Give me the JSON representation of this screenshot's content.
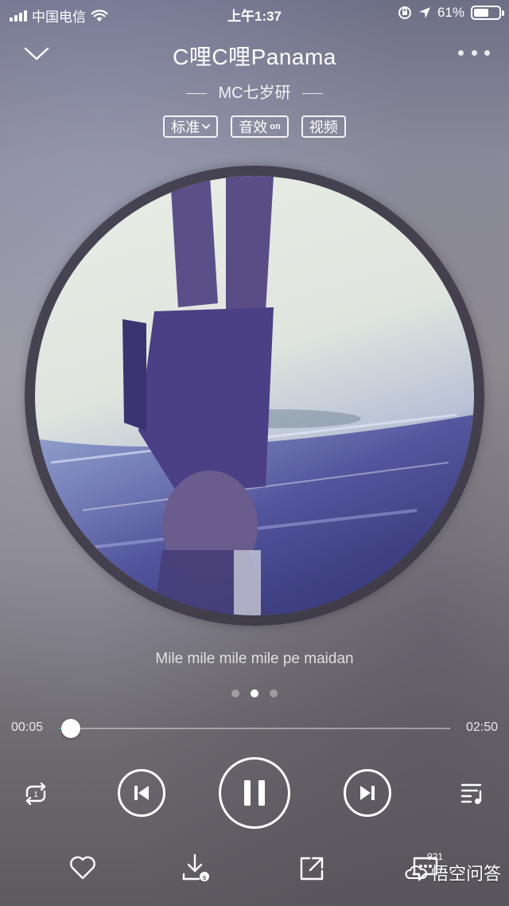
{
  "status_bar": {
    "carrier": "中国电信",
    "time": "上午1:37",
    "battery_text": "61%",
    "battery_level": 0.61
  },
  "header": {
    "title": "C哩C哩Panama",
    "artist": "MC七岁研",
    "chips": {
      "quality": "标准",
      "effects": "音效",
      "effects_state": "on",
      "video": "视频"
    }
  },
  "player": {
    "lyric": "Mile mile mile mile pe maidan",
    "pager_active": 1,
    "current_time": "00:05",
    "total_time": "02:50",
    "progress": 0.03,
    "state": "playing"
  },
  "bottom": {
    "comment_count": "921",
    "watermark": "悟空问答"
  },
  "colors": {
    "accent": "#31c27c"
  },
  "icons": [
    "collapse-chevron-icon",
    "more-icon",
    "repeat-one-icon",
    "previous-icon",
    "pause-icon",
    "next-icon",
    "playlist-icon",
    "heart-icon",
    "download-icon",
    "share-icon",
    "comment-icon"
  ]
}
